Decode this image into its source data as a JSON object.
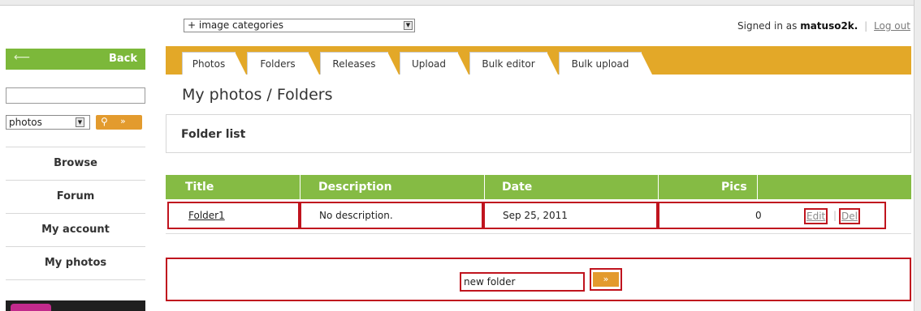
{
  "top": {
    "categories_value": "+ image categories",
    "signed_in_prefix": "Signed in as",
    "username": "matuso2k.",
    "separator": "|",
    "logout": "Log out"
  },
  "sidebar": {
    "back_label": "Back",
    "search_value": "",
    "type_value": "photos",
    "nav": [
      "Browse",
      "Forum",
      "My account",
      "My photos"
    ]
  },
  "tabs": [
    "Photos",
    "Folders",
    "Releases",
    "Upload",
    "Bulk editor",
    "Bulk upload"
  ],
  "page_title": "My photos / Folders",
  "panel_title": "Folder list",
  "table": {
    "headers": [
      "Title",
      "Description",
      "Date",
      "Pics"
    ],
    "rows": [
      {
        "title": "Folder1",
        "description": "No description.",
        "date": "Sep 25, 2011",
        "pics": "0",
        "edit": "Edit",
        "del": "Del"
      }
    ]
  },
  "new_folder": {
    "value": "new folder",
    "button": "»"
  },
  "colors": {
    "green": "#7cb83a",
    "orange": "#e3a828",
    "highlight": "#c0141e"
  }
}
